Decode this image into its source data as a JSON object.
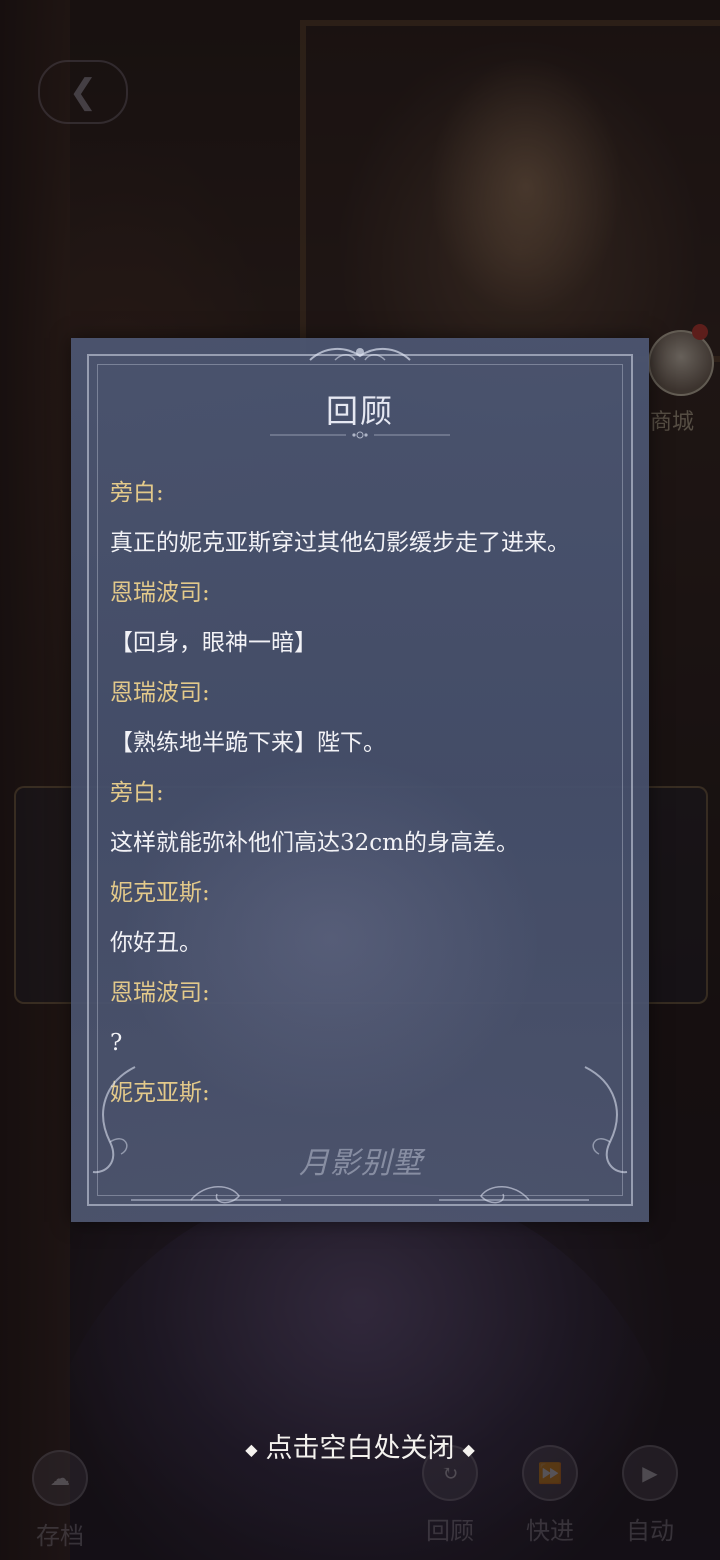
{
  "background_ui": {
    "back_icon": "back-arrow-icon",
    "avatar_label": "商城",
    "bottom_buttons": {
      "save": "存档",
      "review": "回顾",
      "fast_forward": "快进",
      "auto": "自动"
    }
  },
  "review_panel": {
    "title": "回顾",
    "entries": [
      {
        "type": "speaker",
        "text": "旁白:"
      },
      {
        "type": "line",
        "text": "真正的妮克亚斯穿过其他幻影缓步走了进来。"
      },
      {
        "type": "speaker",
        "text": "恩瑞波司:"
      },
      {
        "type": "line",
        "text": "【回身，眼神一暗】"
      },
      {
        "type": "speaker",
        "text": "恩瑞波司:"
      },
      {
        "type": "line",
        "text": "【熟练地半跪下来】陛下。"
      },
      {
        "type": "speaker",
        "text": "旁白:"
      },
      {
        "type": "line",
        "text": "这样就能弥补他们高达32cm的身高差。"
      },
      {
        "type": "speaker",
        "text": "妮克亚斯:"
      },
      {
        "type": "line",
        "text": "你好丑。"
      },
      {
        "type": "speaker",
        "text": "恩瑞波司:"
      },
      {
        "type": "line",
        "text": "?"
      },
      {
        "type": "speaker",
        "text": "妮克亚斯:"
      }
    ],
    "logo_text": "月影别墅"
  },
  "close_hint": "点击空白处关闭",
  "colors": {
    "speaker": "#e3c98a",
    "line": "#f2f2f6",
    "panel": "#4c5672"
  }
}
